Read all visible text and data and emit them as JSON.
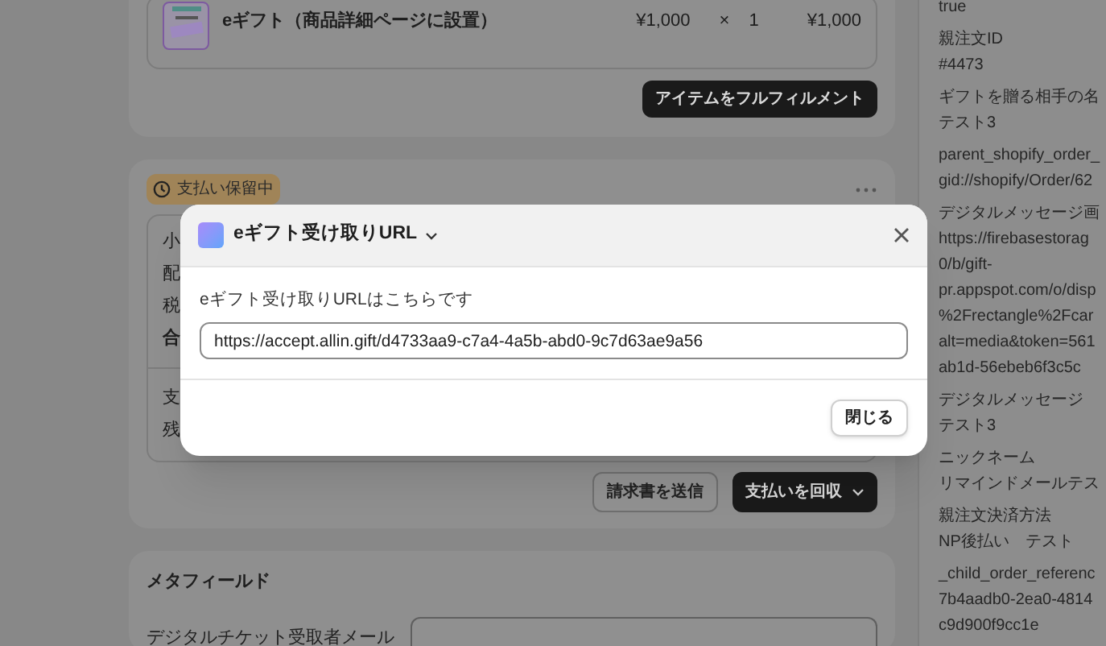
{
  "order_item": {
    "title": "eギフト（商品詳細ページに設置）",
    "unit_price": "¥1,000",
    "multiply": "×",
    "quantity": "1",
    "total": "¥1,000"
  },
  "fulfill_button": "アイテムをフルフィルメント",
  "payment": {
    "status_badge": "支払い保留中",
    "summary_rows": [
      {
        "label": "小",
        "bold": false
      },
      {
        "label": "配",
        "bold": false
      },
      {
        "label": "税",
        "bold": false
      },
      {
        "label": "合",
        "bold": true
      },
      {
        "label": "支",
        "bold": false
      },
      {
        "label": "残",
        "bold": false
      }
    ],
    "buttons": [
      {
        "label": "請求書を送信",
        "kind": "secondary"
      },
      {
        "label": "支払いを回収",
        "kind": "primary"
      }
    ]
  },
  "metafields": {
    "title": "メタフィールド",
    "fields": [
      {
        "label": "デジタルチケット受取者メール"
      }
    ]
  },
  "sidebar": {
    "entries": [
      {
        "values": [
          "true"
        ]
      },
      {
        "label": "親注文ID",
        "values": [
          "#4473"
        ]
      },
      {
        "label": "ギフトを贈る相手の名",
        "values": [
          "テスト3"
        ]
      },
      {
        "label": "parent_shopify_order_",
        "values": [
          "gid://shopify/Order/62"
        ]
      },
      {
        "label": "デジタルメッセージ画",
        "values": [
          "https://firebasestorag",
          "0/b/gift-",
          "pr.appspot.com/o/disp",
          "%2Frectangle%2Fcar",
          "alt=media&token=561",
          "ab1d-56ebeb6f3c5c"
        ]
      },
      {
        "label": "デジタルメッセージ",
        "values": [
          "テスト3"
        ]
      },
      {
        "label": "ニックネーム",
        "values": [
          "リマインドメールテス"
        ]
      },
      {
        "label": "親注文決済方法",
        "values": [
          "NP後払い　テスト"
        ]
      },
      {
        "label": "_child_order_referenc",
        "values": [
          "7b4aadb0-2ea0-4814",
          "c9d900f9cc1e"
        ]
      }
    ]
  },
  "modal": {
    "title": "eギフト受け取りURL",
    "field_label": "eギフト受け取りURLはこちらです",
    "url": "https://accept.allin.gift/d4733aa9-c7a4-4a5b-abd0-9c7d63ae9a56",
    "close_button": "閉じる"
  }
}
